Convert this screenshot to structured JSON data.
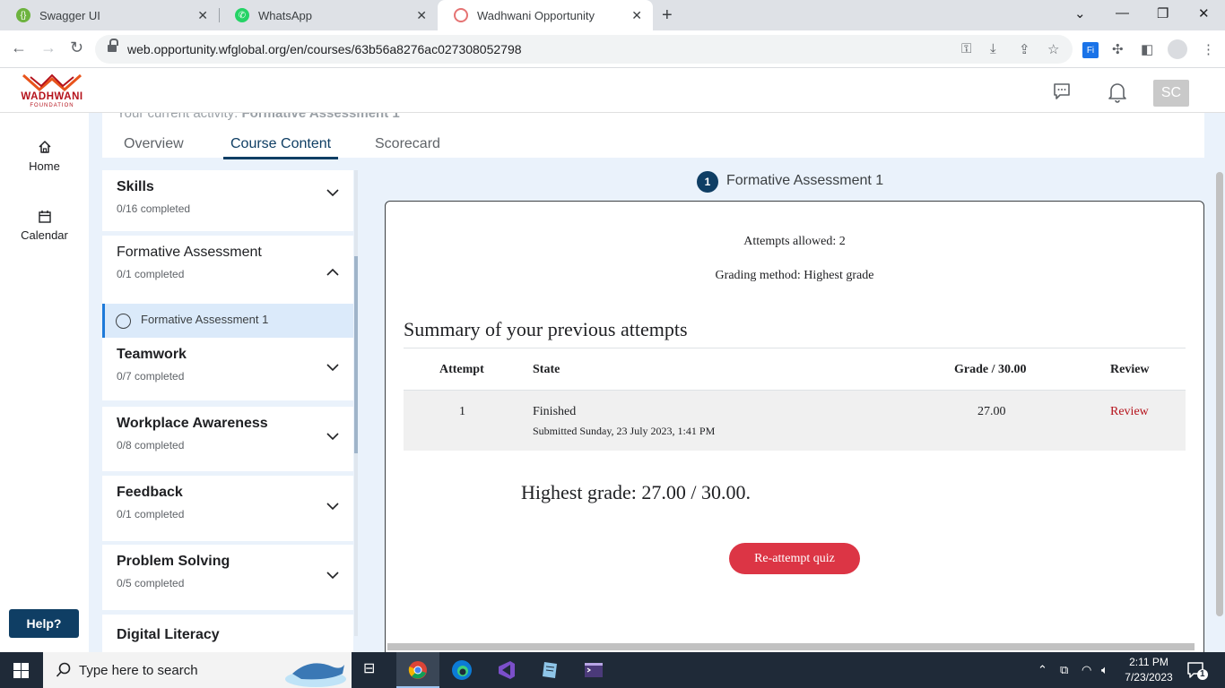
{
  "browser": {
    "tabs": [
      {
        "title": "Swagger UI",
        "icon": "swagger-icon"
      },
      {
        "title": "WhatsApp",
        "icon": "whatsapp-icon"
      },
      {
        "title": "Wadhwani Opportunity",
        "icon": "wadhwani-icon",
        "active": true
      }
    ],
    "url": "web.opportunity.wfglobal.org/en/courses/63b56a8276ac027308052798"
  },
  "header": {
    "logo_name": "WADHWANI",
    "logo_sub": "FOUNDATION",
    "avatar_initials": "SC"
  },
  "rail": {
    "items": [
      {
        "label": "Home",
        "icon": "home-icon"
      },
      {
        "label": "Calendar",
        "icon": "calendar-icon"
      }
    ],
    "help_label": "Help?"
  },
  "course": {
    "current_activity_label": "Your current activity:",
    "current_activity_value": "Formative Assessment 1",
    "tabs": [
      "Overview",
      "Course Content",
      "Scorecard"
    ],
    "selected_tab": "Course Content",
    "sections": [
      {
        "title": "Skills",
        "progress": "0/16 completed",
        "expanded": false
      },
      {
        "title": "Formative Assessment",
        "progress": "0/1 completed",
        "expanded": true
      },
      {
        "title": "Teamwork",
        "progress": "0/7 completed",
        "expanded": false
      },
      {
        "title": "Workplace Awareness",
        "progress": "0/8 completed",
        "expanded": false
      },
      {
        "title": "Feedback",
        "progress": "0/1 completed",
        "expanded": false
      },
      {
        "title": "Problem Solving",
        "progress": "0/5 completed",
        "expanded": false
      },
      {
        "title": "Digital Literacy",
        "progress": "",
        "expanded": false
      }
    ],
    "active_item": "Formative Assessment 1"
  },
  "quiz": {
    "step_number": "1",
    "title": "Formative Assessment 1",
    "attempts_allowed": "Attempts allowed: 2",
    "grading_method": "Grading method: Highest grade",
    "summary_heading": "Summary of your previous attempts",
    "columns": [
      "Attempt",
      "State",
      "Grade / 30.00",
      "Review"
    ],
    "rows": [
      {
        "attempt": "1",
        "state": "Finished",
        "submitted": "Submitted Sunday, 23 July 2023, 1:41 PM",
        "grade": "27.00",
        "review": "Review"
      }
    ],
    "highest_grade": "Highest grade: 27.00 / 30.00.",
    "reattempt_label": "Re-attempt quiz"
  },
  "taskbar": {
    "search_placeholder": "Type here to search",
    "time": "2:11 PM",
    "date": "7/23/2023",
    "notification_count": "1"
  },
  "colors": {
    "brand_navy": "#0f3e64",
    "brand_red": "#b5121b",
    "reattempt_red": "#dc3545",
    "page_bg": "#eaf2fb"
  }
}
